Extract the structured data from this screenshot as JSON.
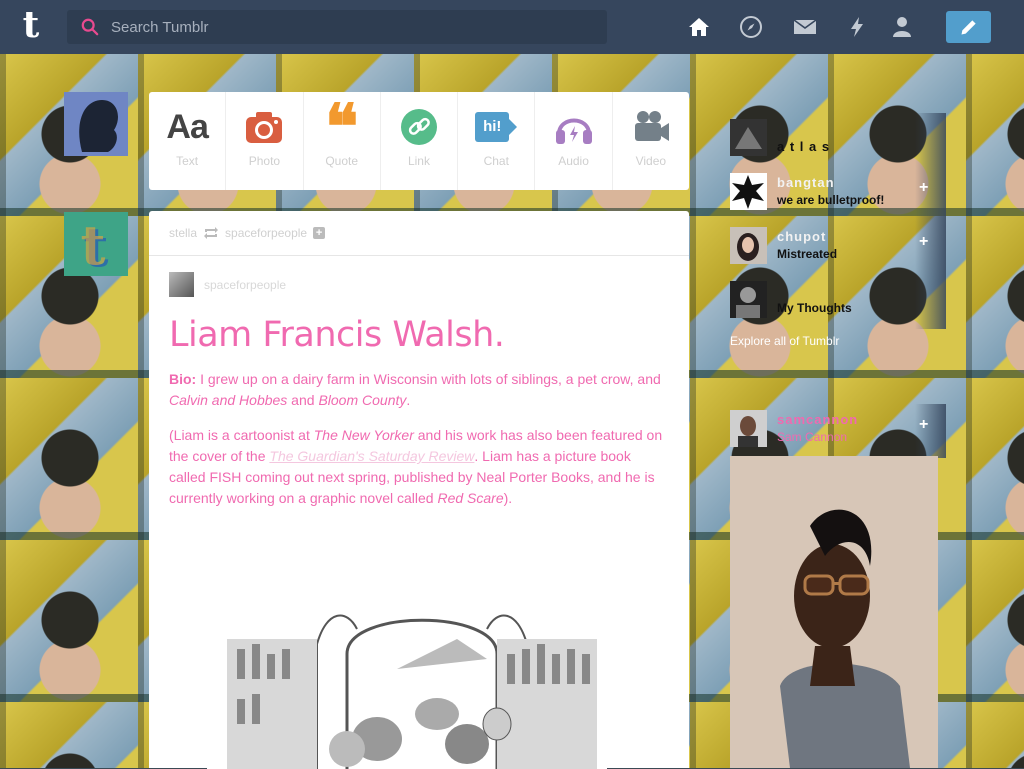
{
  "nav": {
    "logo_letter": "t",
    "search_placeholder": "Search Tumblr",
    "icons": [
      "home-icon",
      "explore-icon",
      "inbox-icon",
      "activity-icon",
      "account-icon",
      "compose-icon"
    ]
  },
  "post_types": [
    {
      "label": "Text",
      "icon": "text-icon",
      "glyph": "Aa",
      "color": "#444444"
    },
    {
      "label": "Photo",
      "icon": "camera-icon",
      "color": "#d95e40"
    },
    {
      "label": "Quote",
      "icon": "quote-icon",
      "glyph": "❝",
      "color": "#f2992e"
    },
    {
      "label": "Link",
      "icon": "link-icon",
      "color": "#56bc8a"
    },
    {
      "label": "Chat",
      "icon": "chat-icon",
      "glyph": "hi!",
      "color": "#529ecc"
    },
    {
      "label": "Audio",
      "icon": "headphones-icon",
      "color": "#a77dc2"
    },
    {
      "label": "Video",
      "icon": "video-camera-icon",
      "color": "#748089"
    }
  ],
  "post": {
    "reblog_from": "stella",
    "reblog_to": "spaceforpeople",
    "source": "spaceforpeople",
    "title": "Liam Francis Walsh.",
    "bio_label": "Bio:",
    "bio_text_1": " I grew up on a dairy farm in Wisconsin with lots of siblings, a pet crow, and ",
    "bio_em_1": "Calvin and Hobbes",
    "bio_text_2": " and ",
    "bio_em_2": "Bloom County",
    "bio_text_3": ".",
    "p2_a": "(Liam is a cartoonist at ",
    "p2_em": "The New Yorker",
    "p2_b": " and his work has also been featured on the cover of the ",
    "p2_link": "The Guardian's Saturday Review",
    "p2_c": ". Liam has a picture book called FISH coming out next spring, published by Neal Porter Books, and he is currently working on a graphic novel called ",
    "p2_em2": "Red Scare",
    "p2_d": ")."
  },
  "recommended": [
    {
      "name": "a t l a s",
      "subtitle": ""
    },
    {
      "name": "bangtan",
      "subtitle": "we are bulletproof!"
    },
    {
      "name": "chupot",
      "subtitle": "Mistreated"
    },
    {
      "name": "",
      "subtitle": "My Thoughts"
    }
  ],
  "explore_label": "Explore all of Tumblr",
  "radar": {
    "name": "samcannon",
    "subtitle": "Sam Cannon"
  },
  "colors": {
    "nav_bg": "#36465d",
    "accent": "#529ecc",
    "post_pink": "#f06ab0"
  }
}
